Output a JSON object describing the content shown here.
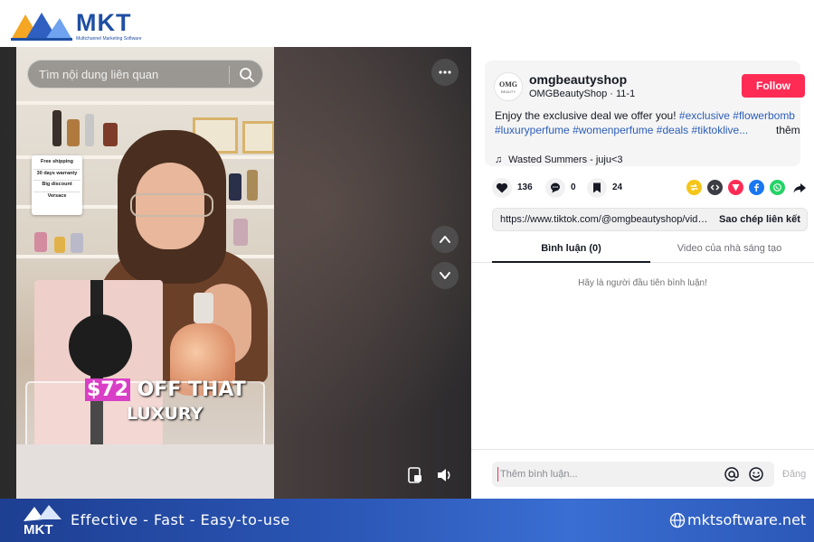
{
  "brand": {
    "name": "MKT",
    "subtitle": "Multichannel Marketing Software"
  },
  "video": {
    "search_placeholder": "Tìm nội dung liên quan",
    "promo_card": [
      "Free shipping",
      "30 days warranty",
      "Big discount",
      "Versace"
    ],
    "overlay": {
      "price": "$72",
      "line1_rest": " OFF THAT",
      "line2": "LUXURY"
    },
    "controls": {
      "more": "more-options-icon",
      "prev": "chevron-up-icon",
      "next": "chevron-down-icon",
      "pip": "floating-player-icon",
      "volume": "volume-icon"
    }
  },
  "post": {
    "avatar_text": "OMG",
    "avatar_sub": "BEAUTY",
    "username": "omgbeautyshop",
    "display_name": "OMGBeautyShop",
    "separator": " · ",
    "date": "11-1",
    "follow_label": "Follow",
    "caption_text": "Enjoy the exclusive deal we offer you! ",
    "hashtags": [
      "#exclusive",
      "#flowerbomb",
      "#luxuryperfume",
      "#womenperfume",
      "#deals",
      "#tiktoklive..."
    ],
    "more_label": "thêm",
    "music": "Wasted Summers - juju<3"
  },
  "actions": {
    "likes": "136",
    "comments": "0",
    "saves": "24"
  },
  "share": {
    "link": "https://www.tiktok.com/@omgbeautyshop/video/",
    "copy_label": "Sao chép liên kết"
  },
  "tabs": {
    "comments": "Bình luận (0)",
    "creator_videos": "Video của nhà sáng tạo"
  },
  "comments": {
    "empty_message": "Hãy là người đầu tiên bình luận!",
    "input_placeholder": "Thêm bình luận...",
    "post_label": "Đăng"
  },
  "footer": {
    "slogan": "Effective - Fast - Easy-to-use",
    "site": "mktsoftware.net"
  },
  "colors": {
    "follow": "#fe2c55",
    "hashtag": "#2b5db9",
    "brand_blue": "#1f4fa3",
    "footer_start": "#1e3f92",
    "footer_end": "#3a6ed2"
  }
}
